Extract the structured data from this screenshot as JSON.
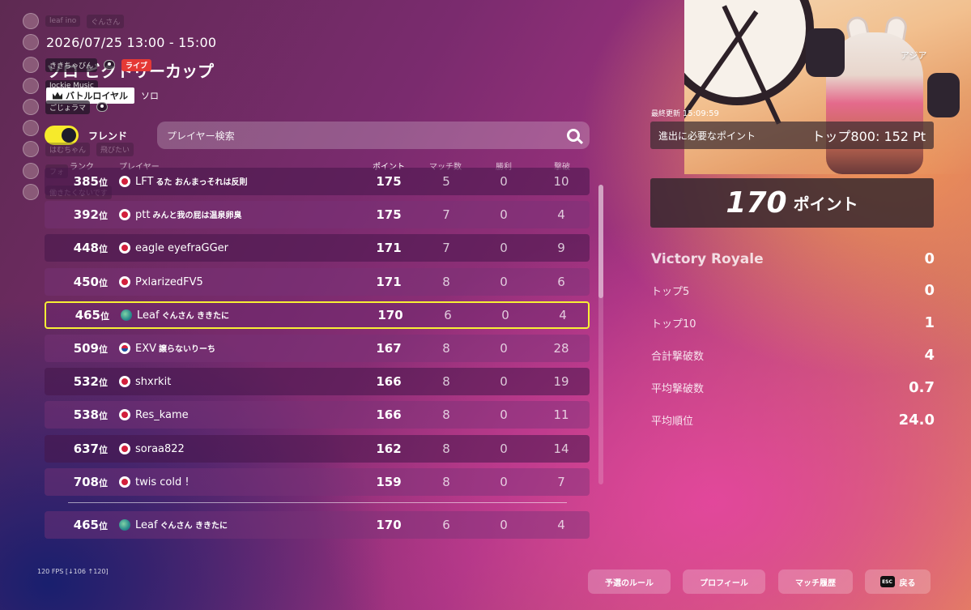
{
  "region": "アジア",
  "overlay": {
    "viewers": [
      {
        "name": "leaf ino",
        "extra": "ぐんさん",
        "dim": true
      },
      {
        "name": "",
        "extra": "",
        "dim": true
      },
      {
        "name": "ききちゃびん",
        "extra": "",
        "dim": false
      },
      {
        "name": "Jockie Music",
        "extra": "",
        "dim": false
      },
      {
        "name": "ごじょラマ",
        "extra": "",
        "dim": false
      },
      {
        "name": "",
        "extra": "",
        "dim": true
      },
      {
        "name": "はむちゃん",
        "extra": "飛びたい",
        "dim": true
      },
      {
        "name": "フォ",
        "extra": "",
        "dim": true
      },
      {
        "name": "働きたくないです",
        "extra": "",
        "dim": true
      }
    ],
    "live_label": "ライブ"
  },
  "event": {
    "datetime": "2026/07/25 13:00 - 15:00",
    "title": "ソロ ビクトリーカップ",
    "mode": "バトルロイヤル",
    "type": "ソロ"
  },
  "filters": {
    "friend_label": "フレンド",
    "friend_toggle": true,
    "search_placeholder": "プレイヤー検索"
  },
  "columns": {
    "rank": "ランク",
    "player": "プレイヤー",
    "points": "ポイント",
    "matches": "マッチ数",
    "wins": "勝利",
    "kills": "撃破"
  },
  "rank_suffix": "位",
  "rows": [
    {
      "rank": "385",
      "flag": "jp",
      "name": "LFT",
      "sub": "るた おんまっそれは反則",
      "points": "175",
      "matches": "5",
      "wins": "0",
      "kills": "10"
    },
    {
      "rank": "392",
      "flag": "jp",
      "name": "ptt",
      "sub": "みんと我の屁は温泉卵臭",
      "points": "175",
      "matches": "7",
      "wins": "0",
      "kills": "4"
    },
    {
      "rank": "448",
      "flag": "jp",
      "name": "eagle eyefraGGer",
      "sub": "",
      "points": "171",
      "matches": "7",
      "wins": "0",
      "kills": "9"
    },
    {
      "rank": "450",
      "flag": "jp",
      "name": "PxlarizedFV5",
      "sub": "",
      "points": "171",
      "matches": "8",
      "wins": "0",
      "kills": "6"
    },
    {
      "rank": "465",
      "flag": "globe",
      "name": "Leaf",
      "sub": "ぐんさん ききたに",
      "points": "170",
      "matches": "6",
      "wins": "0",
      "kills": "4",
      "me": true
    },
    {
      "rank": "509",
      "flag": "kr",
      "name": "EXV",
      "sub": "譲らないりーち",
      "points": "167",
      "matches": "8",
      "wins": "0",
      "kills": "28"
    },
    {
      "rank": "532",
      "flag": "jp",
      "name": "shxrkit",
      "sub": "",
      "points": "166",
      "matches": "8",
      "wins": "0",
      "kills": "19"
    },
    {
      "rank": "538",
      "flag": "jp",
      "name": "Res_kame",
      "sub": "",
      "points": "166",
      "matches": "8",
      "wins": "0",
      "kills": "11"
    },
    {
      "rank": "637",
      "flag": "jp",
      "name": "soraa822",
      "sub": "",
      "points": "162",
      "matches": "8",
      "wins": "0",
      "kills": "14"
    },
    {
      "rank": "708",
      "flag": "jp",
      "name": "twis cold !",
      "sub": "",
      "points": "159",
      "matches": "8",
      "wins": "0",
      "kills": "7"
    }
  ],
  "my_row": {
    "rank": "465",
    "flag": "globe",
    "name": "Leaf",
    "sub": "ぐんさん ききたに",
    "points": "170",
    "matches": "6",
    "wins": "0",
    "kills": "4"
  },
  "summary": {
    "updated_label": "最終更新",
    "updated_time": "15:09:59",
    "qualify_label": "進出に必要なポイント",
    "qualify_value": "トップ800: 152 Pt",
    "total_points": "170",
    "points_unit": "ポイント",
    "stats": [
      {
        "label": "Victory Royale",
        "value": "0",
        "big": true
      },
      {
        "label": "トップ5",
        "value": "0"
      },
      {
        "label": "トップ10",
        "value": "1"
      },
      {
        "label": "合計撃破数",
        "value": "4"
      },
      {
        "label": "平均撃破数",
        "value": "0.7"
      },
      {
        "label": "平均順位",
        "value": "24.0"
      }
    ]
  },
  "fps": "120 FPS [↓106 ↑120]",
  "buttons": {
    "rules": "予選のルール",
    "profile": "プロフィール",
    "history": "マッチ履歴",
    "back": "戻る",
    "esc": "ESC"
  }
}
